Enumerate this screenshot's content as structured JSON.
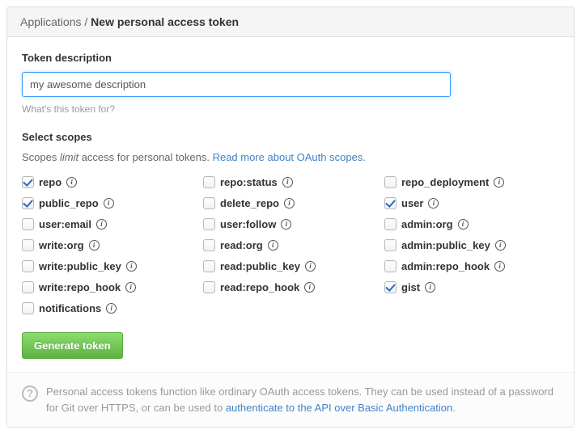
{
  "breadcrumb": {
    "parent": "Applications",
    "sep": " / ",
    "current": "New personal access token"
  },
  "desc": {
    "label": "Token description",
    "value": "my awesome description",
    "help": "What's this token for?"
  },
  "scopes": {
    "label": "Select scopes",
    "help_pre": "Scopes ",
    "help_em": "limit",
    "help_post": " access for personal tokens. ",
    "help_link": "Read more about OAuth scopes.",
    "items": [
      {
        "name": "repo",
        "checked": true
      },
      {
        "name": "repo:status",
        "checked": false
      },
      {
        "name": "repo_deployment",
        "checked": false
      },
      {
        "name": "public_repo",
        "checked": true
      },
      {
        "name": "delete_repo",
        "checked": false
      },
      {
        "name": "user",
        "checked": true
      },
      {
        "name": "user:email",
        "checked": false
      },
      {
        "name": "user:follow",
        "checked": false
      },
      {
        "name": "admin:org",
        "checked": false
      },
      {
        "name": "write:org",
        "checked": false
      },
      {
        "name": "read:org",
        "checked": false
      },
      {
        "name": "admin:public_key",
        "checked": false
      },
      {
        "name": "write:public_key",
        "checked": false
      },
      {
        "name": "read:public_key",
        "checked": false
      },
      {
        "name": "admin:repo_hook",
        "checked": false
      },
      {
        "name": "write:repo_hook",
        "checked": false
      },
      {
        "name": "read:repo_hook",
        "checked": false
      },
      {
        "name": "gist",
        "checked": true
      },
      {
        "name": "notifications",
        "checked": false
      }
    ]
  },
  "button": {
    "generate": "Generate token"
  },
  "footer": {
    "text_pre": "Personal access tokens function like ordinary OAuth access tokens. They can be used instead of a password for Git over HTTPS, or can be used to ",
    "link": "authenticate to the API over Basic Authentication",
    "text_post": "."
  }
}
